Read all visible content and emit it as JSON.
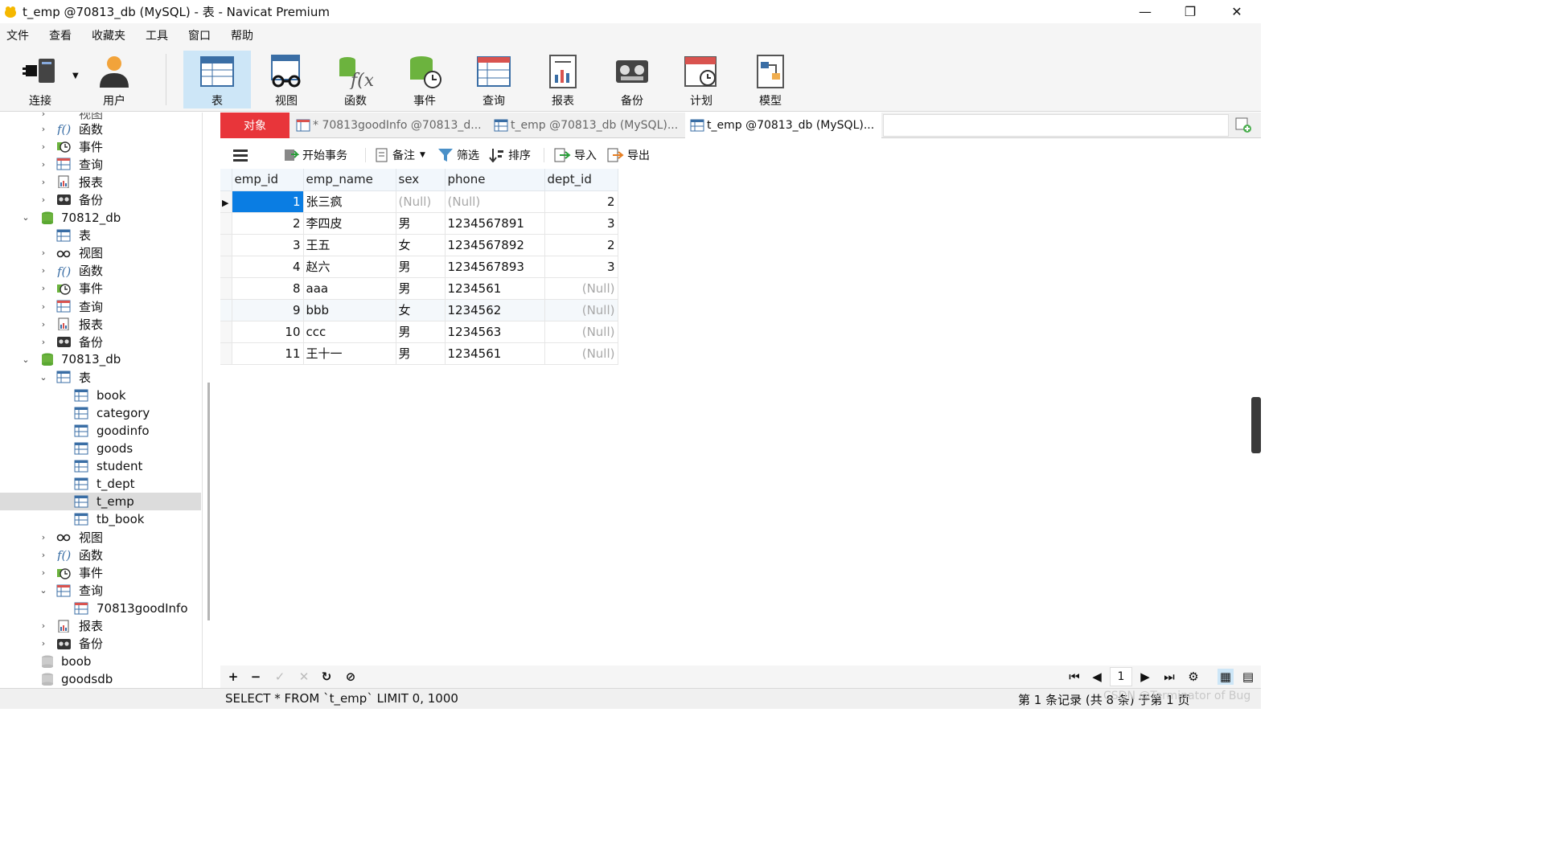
{
  "window": {
    "title": "t_emp @70813_db (MySQL) - 表 - Navicat Premium",
    "controls": {
      "minimize": "—",
      "restore": "❐",
      "close": "✕"
    }
  },
  "menu": [
    "文件",
    "查看",
    "收藏夹",
    "工具",
    "窗口",
    "帮助"
  ],
  "toolbar": {
    "connect": "连接",
    "user": "用户",
    "table": "表",
    "view": "视图",
    "function": "函数",
    "event": "事件",
    "query": "查询",
    "report": "报表",
    "backup": "备份",
    "schedule": "计划",
    "model": "模型"
  },
  "tree": {
    "cut_top": "视图",
    "rows": [
      {
        "label": "函数",
        "icon": "function-icon"
      },
      {
        "label": "事件",
        "icon": "event-icon"
      },
      {
        "label": "查询",
        "icon": "query-icon"
      },
      {
        "label": "报表",
        "icon": "report-icon"
      },
      {
        "label": "备份",
        "icon": "backup-icon"
      },
      {
        "label": "70812_db",
        "icon": "database-icon"
      },
      {
        "label": "表",
        "icon": "table-icon"
      },
      {
        "label": "视图",
        "icon": "view-icon"
      },
      {
        "label": "函数",
        "icon": "function-icon"
      },
      {
        "label": "事件",
        "icon": "event-icon"
      },
      {
        "label": "查询",
        "icon": "query-icon"
      },
      {
        "label": "报表",
        "icon": "report-icon"
      },
      {
        "label": "备份",
        "icon": "backup-icon"
      },
      {
        "label": "70813_db",
        "icon": "database-icon"
      },
      {
        "label": "表",
        "icon": "table-icon"
      },
      {
        "label": "book",
        "icon": "table-icon"
      },
      {
        "label": "category",
        "icon": "table-icon"
      },
      {
        "label": "goodinfo",
        "icon": "table-icon"
      },
      {
        "label": "goods",
        "icon": "table-icon"
      },
      {
        "label": "student",
        "icon": "table-icon"
      },
      {
        "label": "t_dept",
        "icon": "table-icon"
      },
      {
        "label": "t_emp",
        "icon": "table-icon"
      },
      {
        "label": "tb_book",
        "icon": "table-icon"
      },
      {
        "label": "视图",
        "icon": "view-icon"
      },
      {
        "label": "函数",
        "icon": "function-icon"
      },
      {
        "label": "事件",
        "icon": "event-icon"
      },
      {
        "label": "查询",
        "icon": "query-icon"
      },
      {
        "label": "70813goodInfo",
        "icon": "query-icon"
      },
      {
        "label": "报表",
        "icon": "report-icon"
      },
      {
        "label": "备份",
        "icon": "backup-icon"
      },
      {
        "label": "boob",
        "icon": "database-icon"
      },
      {
        "label": "goodsdb",
        "icon": "database-icon"
      }
    ]
  },
  "tabs": [
    {
      "label": "对象"
    },
    {
      "label": "* 70813goodInfo @70813_d..."
    },
    {
      "label": "t_emp @70813_db (MySQL)..."
    },
    {
      "label": "t_emp @70813_db (MySQL)..."
    }
  ],
  "subtoolbar": {
    "begin_tx": "开始事务",
    "memo": "备注",
    "filter": "筛选",
    "sort": "排序",
    "import": "导入",
    "export": "导出"
  },
  "grid": {
    "columns": [
      "emp_id",
      "emp_name",
      "sex",
      "phone",
      "dept_id"
    ],
    "rows": [
      [
        "1",
        "张三疯",
        "(Null)",
        "(Null)",
        "2"
      ],
      [
        "2",
        "李四皮",
        "男",
        "1234567891",
        "3"
      ],
      [
        "3",
        "王五",
        "女",
        "1234567892",
        "2"
      ],
      [
        "4",
        "赵六",
        "男",
        "1234567893",
        "3"
      ],
      [
        "8",
        "aaa",
        "男",
        "1234561",
        "(Null)"
      ],
      [
        "9",
        "bbb",
        "女",
        "1234562",
        "(Null)"
      ],
      [
        "10",
        "ccc",
        "男",
        "1234563",
        "(Null)"
      ],
      [
        "11",
        "王十一",
        "男",
        "1234561",
        "(Null)"
      ]
    ]
  },
  "bottom": {
    "page": "1"
  },
  "status": {
    "sql": "SELECT * FROM `t_emp` LIMIT 0, 1000",
    "records": "第 1 条记录 (共 8 条) 于第 1 页",
    "watermark": "CSDN @Terminator of Bug"
  },
  "colors": {
    "accent": "#0a7de3",
    "tab_active_red": "#e8353a",
    "toolbar_active": "#cde6f7"
  }
}
